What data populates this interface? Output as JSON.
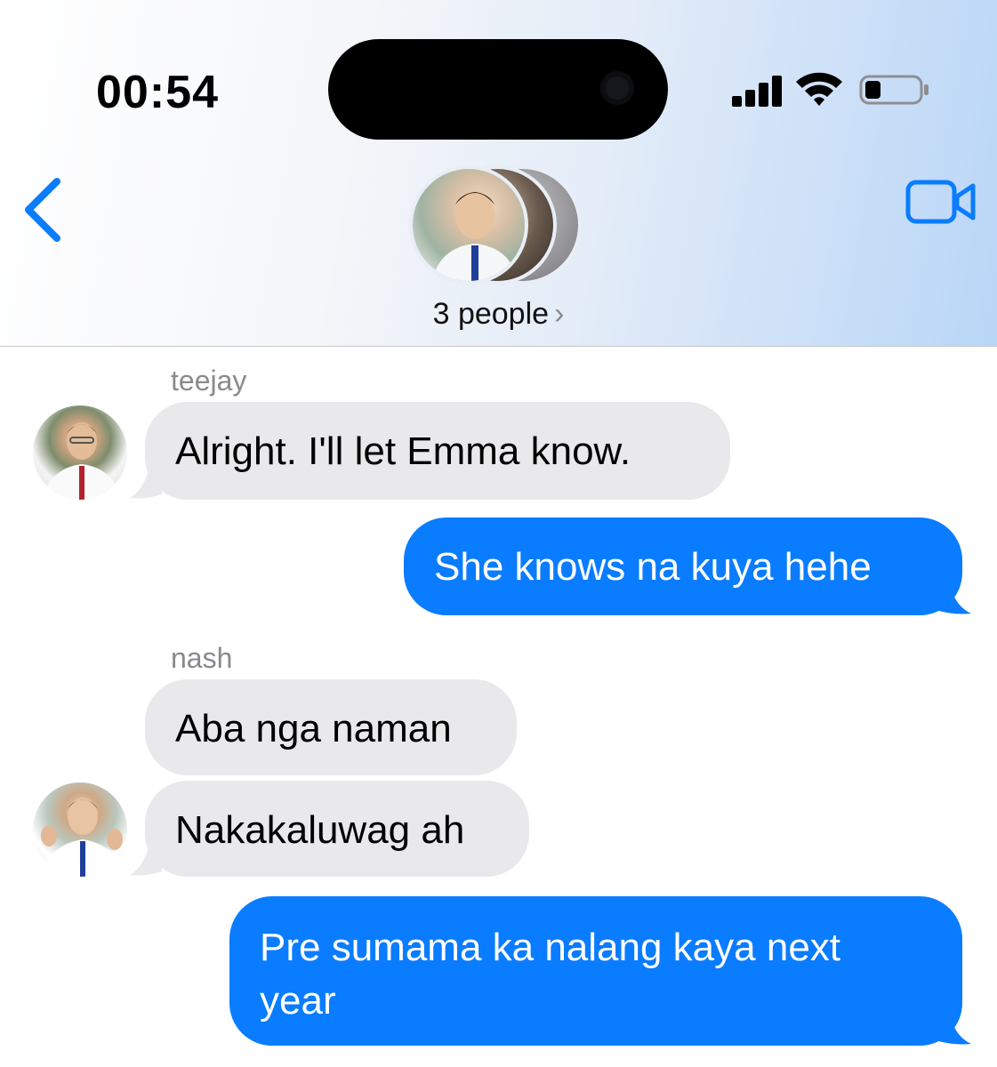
{
  "status_bar": {
    "time": "00:54",
    "signal_icon": "cellular-signal-icon",
    "wifi_icon": "wifi-icon",
    "battery_icon": "battery-icon",
    "battery_level": 0.3
  },
  "header": {
    "back_icon": "chevron-left-icon",
    "video_icon": "video-camera-icon",
    "group_label": "3 people",
    "group_chevron": "›",
    "accent_color": "#0a7cff"
  },
  "messages": [
    {
      "sender": "teejay",
      "direction": "incoming",
      "text": "Alright. I'll let Emma know."
    },
    {
      "sender": "",
      "direction": "outgoing",
      "text": "She knows na kuya hehe"
    },
    {
      "sender": "nash",
      "direction": "incoming",
      "text": "Aba nga naman"
    },
    {
      "sender": "",
      "direction": "incoming",
      "text": "Nakakaluwag ah"
    },
    {
      "sender": "",
      "direction": "outgoing",
      "text_line1": "Pre sumama ka nalang kaya next",
      "text_line2": "year"
    }
  ],
  "colors": {
    "incoming_bubble": "#e9e9eb",
    "outgoing_bubble": "#0a7cff",
    "sender_name": "#8a8a8e"
  }
}
